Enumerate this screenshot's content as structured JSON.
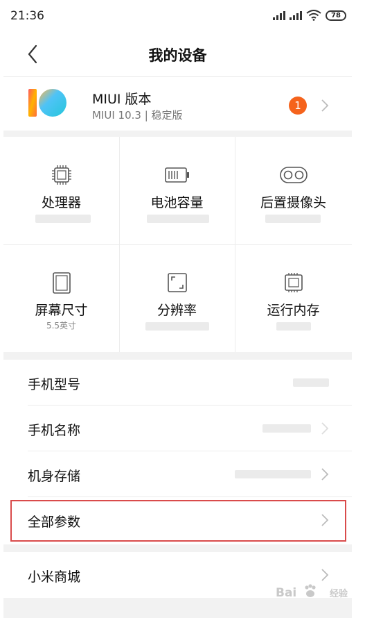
{
  "status_bar": {
    "time": "21:36",
    "battery": "78",
    "icons": [
      "signal-icon",
      "signal-icon",
      "wifi-icon",
      "battery-icon"
    ]
  },
  "header": {
    "back_icon": "chevron-left-icon",
    "title": "我的设备"
  },
  "miui": {
    "title": "MIUI 版本",
    "subtitle": "MIUI 10.3 | 稳定版",
    "badge": "1",
    "accent": "#f5631c"
  },
  "specs": [
    {
      "label": "处理器",
      "value": "",
      "icon": "cpu-icon"
    },
    {
      "label": "电池容量",
      "value": "",
      "icon": "battery-capacity-icon"
    },
    {
      "label": "后置摄像头",
      "value": "",
      "icon": "dual-camera-icon"
    },
    {
      "label": "屏幕尺寸",
      "value": "5.5英寸",
      "icon": "screen-size-icon"
    },
    {
      "label": "分辨率",
      "value": "",
      "icon": "resolution-icon"
    },
    {
      "label": "运行内存",
      "value": "",
      "icon": "ram-icon"
    }
  ],
  "list": {
    "model": "手机型号",
    "name": "手机名称",
    "storage": "机身存储",
    "all_params": "全部参数",
    "mi_store": "小米商城"
  },
  "watermark": {
    "text": "Bai",
    "sub": "经验"
  },
  "colors": {
    "highlight": "#d94b4b",
    "divider": "#ececec",
    "section_gap": "#f2f2f2"
  }
}
